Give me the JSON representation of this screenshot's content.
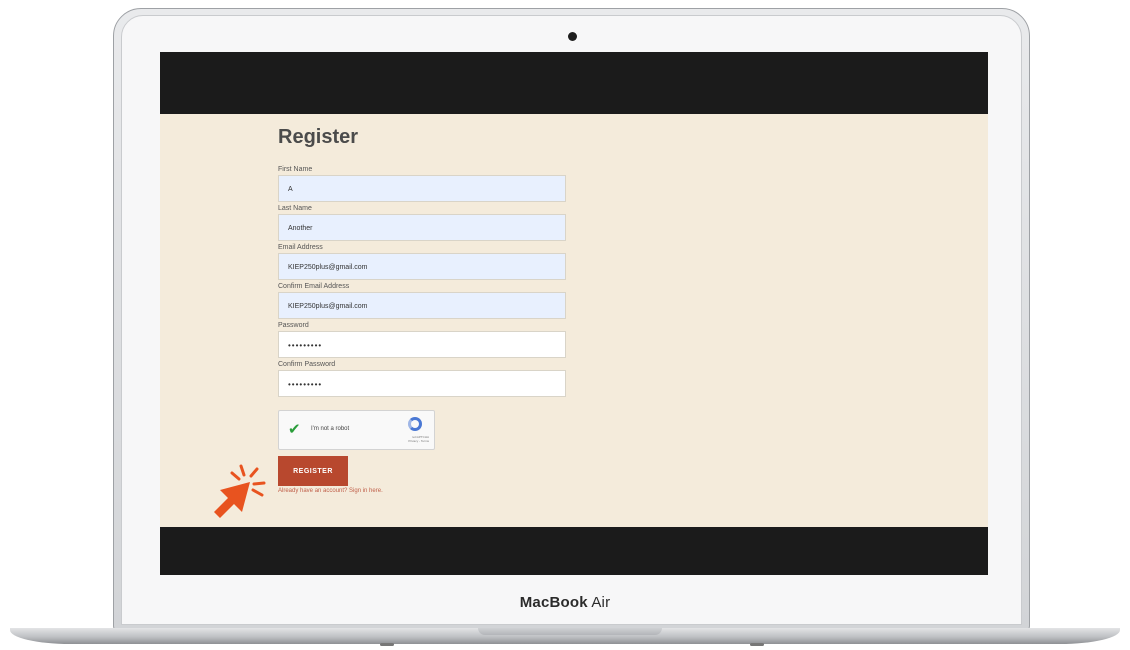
{
  "device": {
    "brand_bold": "MacBook",
    "brand_light": " Air"
  },
  "form": {
    "title": "Register",
    "fields": [
      {
        "label": "First Name",
        "value": "A"
      },
      {
        "label": "Last Name",
        "value": "Another"
      },
      {
        "label": "Email Address",
        "value": "KIEP250plus@gmail.com"
      },
      {
        "label": "Confirm Email Address",
        "value": "KIEP250plus@gmail.com"
      },
      {
        "label": "Password",
        "value": "•••••••••"
      },
      {
        "label": "Confirm Password",
        "value": "•••••••••"
      }
    ],
    "captcha": {
      "label": "I'm not a robot",
      "brand": "reCAPTCHA",
      "links": "Privacy - Terms"
    },
    "register_button": "REGISTER",
    "signin_link": "Already have an account? Sign in here."
  },
  "colors": {
    "accent": "#b8482e",
    "pointer": "#e8531f",
    "page_bg": "#f4ebdb"
  },
  "annotation": {
    "icon": "cursor-click-icon"
  }
}
